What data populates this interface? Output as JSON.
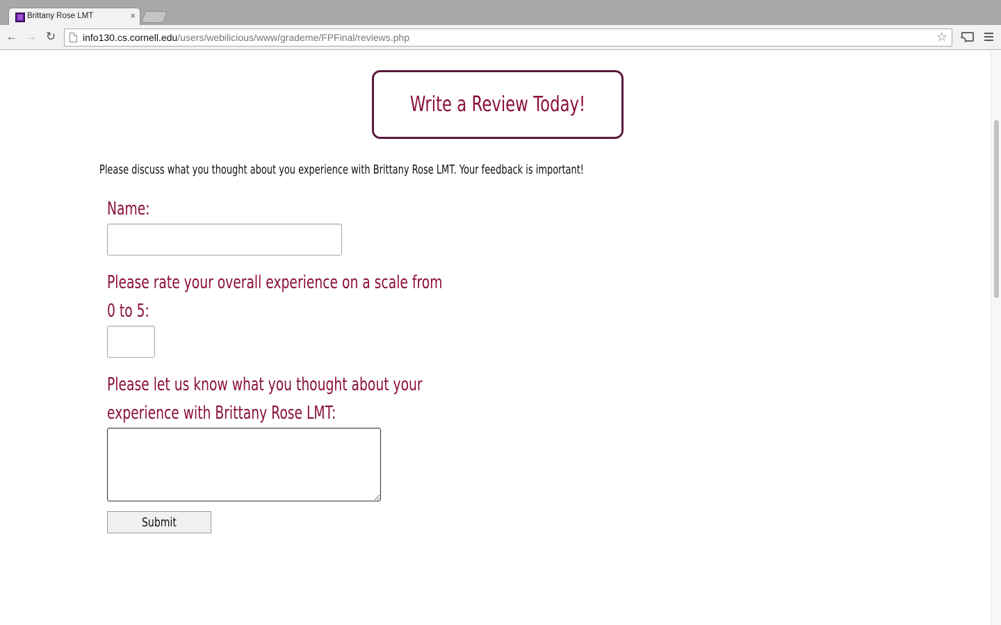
{
  "browser": {
    "tab_title": "Brittany Rose LMT",
    "tab_close": "×",
    "url_host": "info130.cs.cornell.edu",
    "url_path": "/users/webilicious/www/grademe/FPFinal/reviews.php"
  },
  "icons": {
    "back": "back-arrow-icon",
    "forward": "forward-arrow-icon",
    "reload": "reload-icon",
    "bookmark": "star-icon",
    "cast": "cast-icon",
    "menu": "hamburger-menu-icon"
  },
  "page": {
    "heading": "Write a Review Today!",
    "intro": "Please discuss what you thought about you experience with Brittany Rose LMT. Your feedback is important!",
    "form": {
      "name_label": "Name:",
      "name_value": "",
      "rating_label_line1": "Please rate your overall experience on a scale from",
      "rating_label_line2": "0 to 5:",
      "rating_value": "",
      "comments_label_line1": "Please let us know what you thought about your",
      "comments_label_line2": "experience with Brittany Rose LMT:",
      "comments_value": "",
      "submit_label": "Submit"
    }
  },
  "colors": {
    "accent": "#8a0f3c",
    "heading_border": "#5a1a3a"
  }
}
